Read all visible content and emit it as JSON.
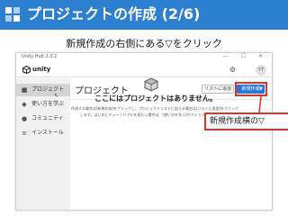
{
  "slide": {
    "title": "プロジェクトの作成 (2/6)",
    "subtitle": "新規作成の右側にある▽をクリック",
    "callout": "新規作成横の▽"
  },
  "window": {
    "title": "Unity Hub 2.3.2",
    "controls": "— ☐ ✕",
    "brand": "unity",
    "avatar_initial": "YT"
  },
  "sidebar": {
    "items": [
      {
        "label": "プロジェクト",
        "icon": "cube-icon",
        "active": true
      },
      {
        "label": "使い方を学ぶ",
        "icon": "graduation-cap-icon",
        "active": false
      },
      {
        "label": "コミュニティ",
        "icon": "people-icon",
        "active": false
      },
      {
        "label": "インストール",
        "icon": "list-icon",
        "active": false
      }
    ]
  },
  "main": {
    "title": "プロジェクト",
    "list_button": "リストに追加",
    "new_button": "新規作成",
    "new_dropdown": "▼",
    "empty_heading": "ここにはプロジェクトはありません。",
    "empty_description": "作成する場合は[新規作成]をクリックし、プロジェクトリストに加える場合は[リストに追加]をクリックします。はじめにチュートリアルを見たい場合は、[使い方を学ぶ]セクションに移動します。"
  },
  "colors": {
    "title_bar": "#2d7fd0",
    "accent": "#2b78d4",
    "callout_border": "#e0302b"
  }
}
